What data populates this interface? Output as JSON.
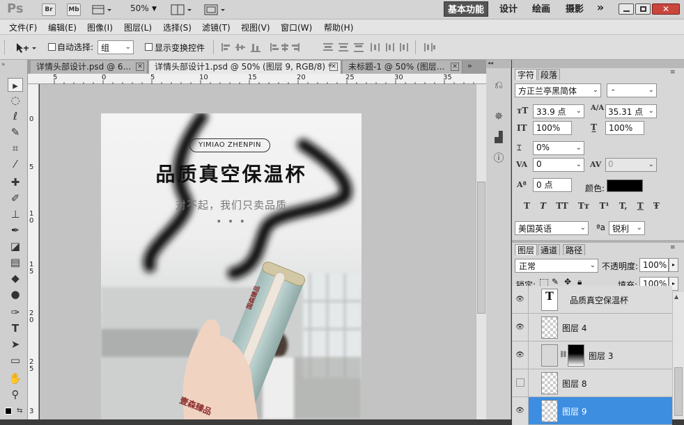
{
  "app": {
    "logo": "Ps",
    "bridge_label": "Br",
    "minibridge_label": "Mb",
    "zoom": "50%",
    "workspaces": [
      "基本功能",
      "设计",
      "绘画",
      "摄影"
    ],
    "more_label": "»"
  },
  "menu": [
    "文件(F)",
    "编辑(E)",
    "图像(I)",
    "图层(L)",
    "选择(S)",
    "滤镜(T)",
    "视图(V)",
    "窗口(W)",
    "帮助(H)"
  ],
  "options": {
    "auto_select_label": "自动选择:",
    "auto_select_value": "组",
    "show_transform_label": "显示变换控件"
  },
  "tabs": [
    {
      "label": "详情头部设计.psd @ 6...",
      "active": false
    },
    {
      "label": "详情头部设计1.psd @ 50% (图层 9, RGB/8) *",
      "active": true
    },
    {
      "label": "未标题-1 @ 50% (图层...",
      "active": false
    }
  ],
  "ruler": {
    "h": [
      "5",
      "0",
      "5",
      "10",
      "15",
      "20",
      "25",
      "30",
      "35"
    ],
    "v": [
      "0",
      "5",
      "1 0",
      "1 5",
      "2 0",
      "2 5",
      "3"
    ]
  },
  "document": {
    "brand": "YIMIAO ZHENPIN",
    "title": "品质真空保温杯",
    "subtitle": "对不起，我们只卖品质",
    "dots": "• • •",
    "bottle_text": "壹森臻品",
    "bottle_badge": "国森臻品"
  },
  "character_panel": {
    "tabs": [
      "字符",
      "段落"
    ],
    "font_family": "方正兰亭黑简体",
    "font_style": "-",
    "font_size": "33.9 点",
    "leading": "35.31 点",
    "vertical_scale": "100%",
    "horizontal_scale": "100%",
    "tsume": "0%",
    "tracking": "0",
    "kerning": "0",
    "baseline_shift": "0 点",
    "color_label": "颜色:",
    "color_value": "#000000",
    "style_buttons": [
      "T",
      "T",
      "TT",
      "Tт",
      "T¹",
      "T,",
      "T",
      "Ŧ"
    ],
    "language": "美国英语",
    "aa_label": "ªa",
    "antialias": "锐利"
  },
  "layers_panel": {
    "tabs": [
      "图层",
      "通道",
      "路径"
    ],
    "blend_mode": "正常",
    "opacity_label": "不透明度:",
    "opacity": "100%",
    "lock_label": "锁定:",
    "fill_label": "填充:",
    "fill": "100%",
    "layers": [
      {
        "name": "品质真空保温杯",
        "type": "text",
        "visible": true,
        "selected": false
      },
      {
        "name": "图层 4",
        "type": "pixel",
        "visible": true,
        "selected": false
      },
      {
        "name": "图层 3",
        "type": "masked",
        "visible": true,
        "selected": false
      },
      {
        "name": "图层 8",
        "type": "pixel",
        "visible": false,
        "selected": false
      },
      {
        "name": "图层 9",
        "type": "pixel",
        "visible": true,
        "selected": true
      }
    ]
  }
}
